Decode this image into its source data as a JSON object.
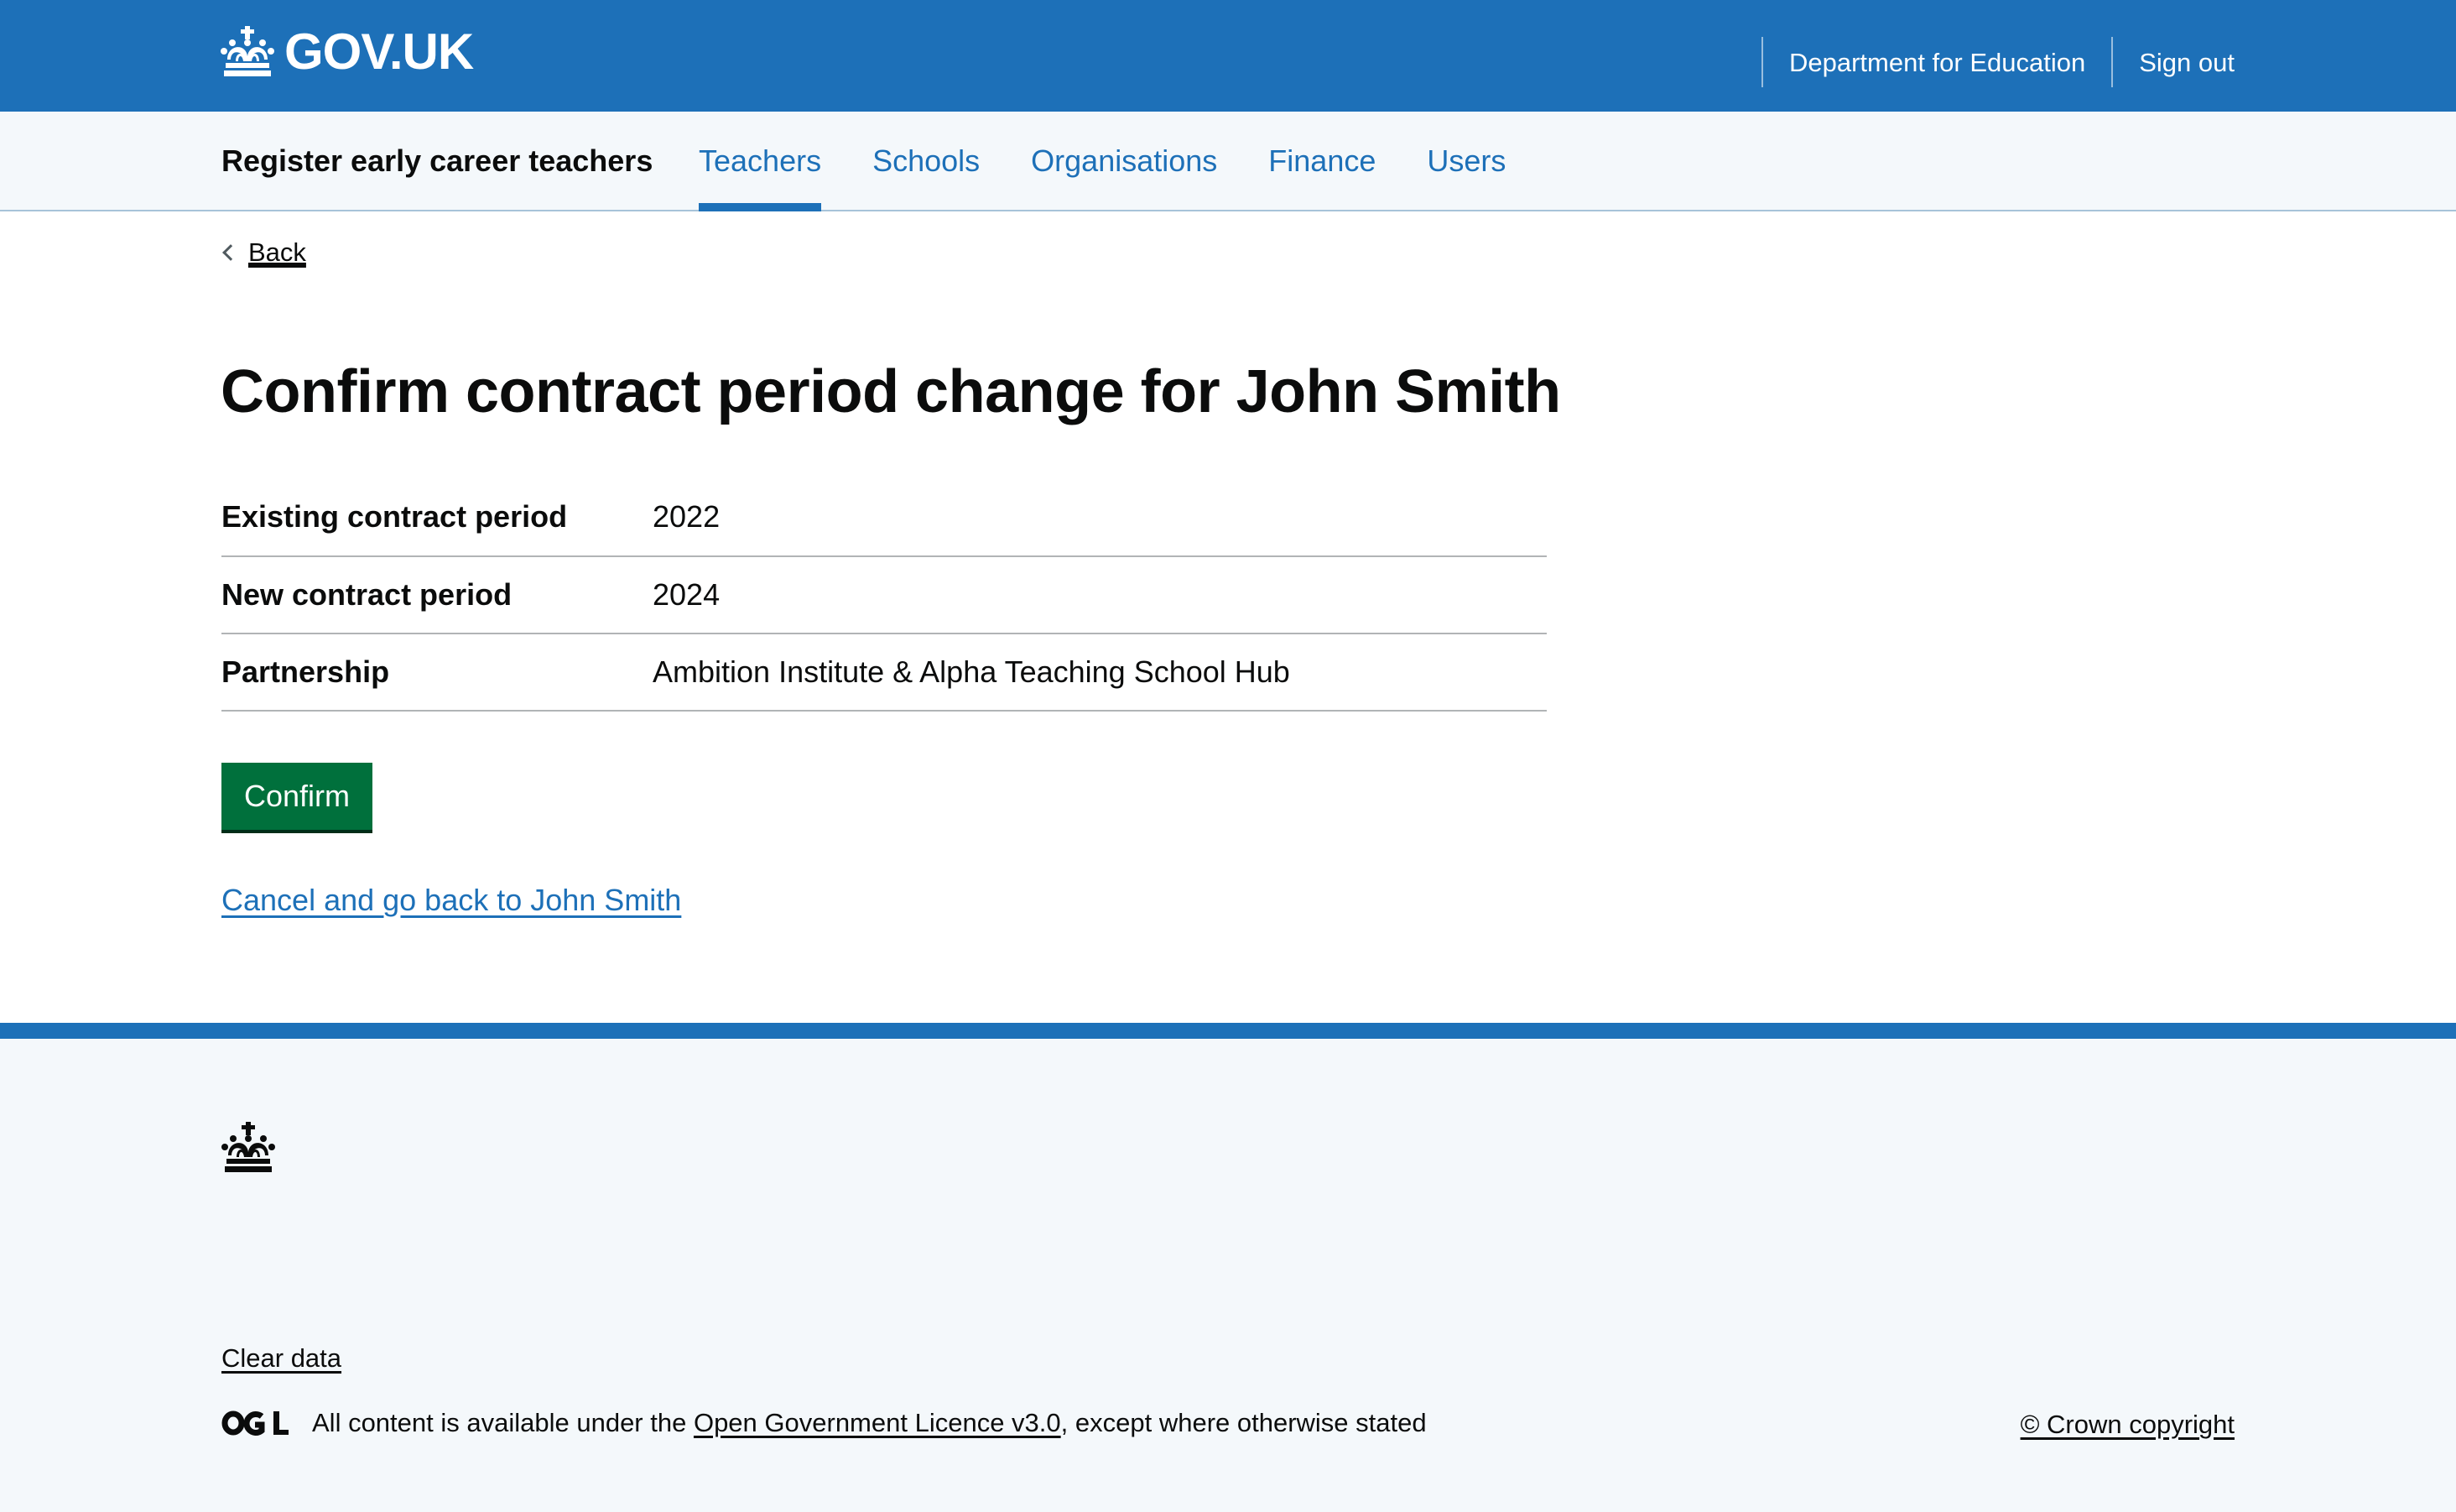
{
  "header": {
    "logo_text": "GOV.UK",
    "links": [
      {
        "label": "Department for Education"
      },
      {
        "label": "Sign out"
      }
    ]
  },
  "service_nav": {
    "service_name": "Register early career teachers",
    "items": [
      {
        "label": "Teachers",
        "active": true
      },
      {
        "label": "Schools",
        "active": false
      },
      {
        "label": "Organisations",
        "active": false
      },
      {
        "label": "Finance",
        "active": false
      },
      {
        "label": "Users",
        "active": false
      }
    ]
  },
  "main": {
    "back_label": "Back",
    "title": "Confirm contract period change for John Smith",
    "summary": [
      {
        "key": "Existing contract period",
        "value": "2022"
      },
      {
        "key": "New contract period",
        "value": "2024"
      },
      {
        "key": "Partnership",
        "value": "Ambition Institute & Alpha Teaching School Hub"
      }
    ],
    "confirm_label": "Confirm",
    "cancel_label": "Cancel and go back to John Smith"
  },
  "footer": {
    "clear_data_label": "Clear data",
    "licence_prefix": "All content is available under the ",
    "licence_link": "Open Government Licence v3.0",
    "licence_suffix": ", except where otherwise stated",
    "copyright": "© Crown copyright"
  },
  "colors": {
    "brand_blue": "#1d70b8",
    "button_green": "#00703c",
    "footer_bg": "#f4f8fb"
  },
  "icons": {
    "logo": "crown-icon",
    "back": "chevron-left-icon",
    "licence": "ogl-logo"
  }
}
